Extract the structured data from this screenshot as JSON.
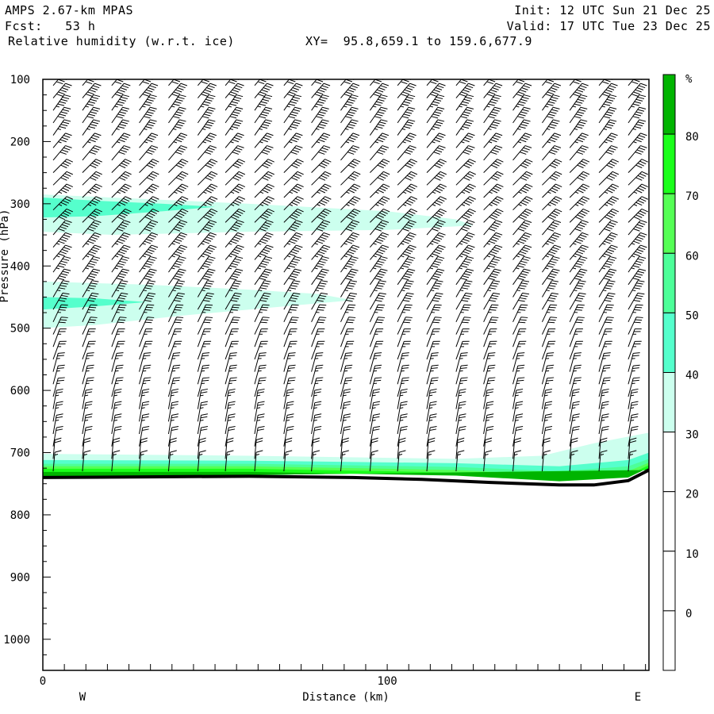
{
  "header": {
    "model": "AMPS 2.67-km MPAS",
    "forecast": "Fcst:   53 h",
    "field": "Relative humidity (w.r.t. ice)",
    "xy": "XY=  95.8,659.1 to 159.6,677.9",
    "init": "Init: 12 UTC Sun 21 Dec 25",
    "valid": "Valid: 17 UTC Tue 23 Dec 25"
  },
  "chart_data": {
    "type": "heatmap",
    "title": "Relative humidity (w.r.t. ice)",
    "xlabel": "Distance (km)",
    "ylabel": "Pressure (hPa)",
    "xlim": [
      0,
      176
    ],
    "ylim": [
      1050,
      100
    ],
    "xticks": [
      "0",
      "100"
    ],
    "xtick_values": [
      0,
      100
    ],
    "yticks": [
      "100",
      "200",
      "300",
      "400",
      "500",
      "600",
      "700",
      "800",
      "900",
      "1000"
    ],
    "ytick_values": [
      100,
      200,
      300,
      400,
      500,
      600,
      700,
      800,
      900,
      1000
    ],
    "left_label": "W",
    "right_label": "E",
    "colorbar": {
      "unit": "%",
      "labels": [
        "80",
        "70",
        "60",
        "50",
        "40",
        "30",
        "20",
        "10",
        "0"
      ],
      "levels": [
        90,
        80,
        70,
        60,
        50,
        40,
        30,
        20,
        10,
        0,
        -10
      ],
      "colors": [
        "#00b400",
        "#1aff1a",
        "#55ff55",
        "#4dff99",
        "#55ffcc",
        "#ccffee",
        "#ffffff",
        "#ffffff",
        "#ffffff",
        "#ffffff"
      ]
    },
    "terrain_hpa": [
      [
        0,
        740
      ],
      [
        30,
        739
      ],
      [
        60,
        738
      ],
      [
        90,
        740
      ],
      [
        110,
        743
      ],
      [
        130,
        748
      ],
      [
        150,
        752
      ],
      [
        160,
        752
      ],
      [
        170,
        745
      ],
      [
        176,
        728
      ]
    ],
    "rh_regions": [
      {
        "rh": 35,
        "poly": [
          [
            0,
            285
          ],
          [
            20,
            290
          ],
          [
            60,
            300
          ],
          [
            100,
            312
          ],
          [
            120,
            325
          ],
          [
            125,
            335
          ],
          [
            100,
            342
          ],
          [
            60,
            345
          ],
          [
            20,
            350
          ],
          [
            0,
            345
          ]
        ]
      },
      {
        "rh": 45,
        "poly": [
          [
            0,
            290
          ],
          [
            15,
            295
          ],
          [
            35,
            300
          ],
          [
            50,
            305
          ],
          [
            35,
            312
          ],
          [
            15,
            320
          ],
          [
            0,
            322
          ]
        ]
      },
      {
        "rh": 35,
        "poly": [
          [
            0,
            425
          ],
          [
            30,
            430
          ],
          [
            60,
            438
          ],
          [
            80,
            445
          ],
          [
            90,
            455
          ],
          [
            70,
            465
          ],
          [
            40,
            480
          ],
          [
            15,
            495
          ],
          [
            0,
            500
          ]
        ]
      },
      {
        "rh": 45,
        "poly": [
          [
            0,
            450
          ],
          [
            15,
            452
          ],
          [
            30,
            458
          ],
          [
            15,
            465
          ],
          [
            0,
            470
          ]
        ]
      },
      {
        "rh": 35,
        "poly": [
          [
            0,
            702
          ],
          [
            60,
            705
          ],
          [
            120,
            710
          ],
          [
            145,
            705
          ],
          [
            160,
            685
          ],
          [
            176,
            668
          ],
          [
            176,
            728
          ],
          [
            0,
            740
          ]
        ]
      },
      {
        "rh": 45,
        "poly": [
          [
            0,
            712
          ],
          [
            60,
            713
          ],
          [
            120,
            717
          ],
          [
            150,
            722
          ],
          [
            170,
            712
          ],
          [
            176,
            700
          ],
          [
            176,
            728
          ],
          [
            0,
            740
          ]
        ]
      },
      {
        "rh": 55,
        "poly": [
          [
            0,
            718
          ],
          [
            60,
            718
          ],
          [
            120,
            723
          ],
          [
            150,
            730
          ],
          [
            170,
            722
          ],
          [
            176,
            710
          ],
          [
            176,
            728
          ],
          [
            0,
            740
          ]
        ]
      },
      {
        "rh": 65,
        "poly": [
          [
            0,
            722
          ],
          [
            60,
            722
          ],
          [
            120,
            728
          ],
          [
            150,
            736
          ],
          [
            170,
            730
          ],
          [
            176,
            716
          ],
          [
            176,
            728
          ],
          [
            0,
            740
          ]
        ]
      },
      {
        "rh": 75,
        "poly": [
          [
            0,
            726
          ],
          [
            60,
            726
          ],
          [
            120,
            732
          ],
          [
            150,
            741
          ],
          [
            170,
            736
          ],
          [
            176,
            720
          ],
          [
            176,
            728
          ],
          [
            0,
            740
          ]
        ]
      },
      {
        "rh": 85,
        "poly": [
          [
            0,
            731
          ],
          [
            60,
            731
          ],
          [
            120,
            737
          ],
          [
            150,
            746
          ],
          [
            170,
            740
          ],
          [
            176,
            724
          ],
          [
            176,
            728
          ],
          [
            0,
            740
          ]
        ]
      }
    ],
    "wind_columns_km": [
      3,
      11.5,
      20,
      28,
      36.5,
      45,
      53,
      61.5,
      70,
      78,
      86.5,
      95,
      103,
      111.5,
      120,
      128,
      136.5,
      145,
      153,
      161.5,
      170
    ],
    "wind_profile": [
      [
        110,
        60,
        40
      ],
      [
        130,
        60,
        40
      ],
      [
        150,
        55,
        35
      ],
      [
        170,
        50,
        35
      ],
      [
        190,
        45,
        35
      ],
      [
        210,
        45,
        40
      ],
      [
        230,
        40,
        40
      ],
      [
        250,
        40,
        45
      ],
      [
        270,
        40,
        45
      ],
      [
        290,
        45,
        45
      ],
      [
        310,
        45,
        45
      ],
      [
        330,
        50,
        45
      ],
      [
        350,
        50,
        40
      ],
      [
        370,
        55,
        40
      ],
      [
        390,
        55,
        40
      ],
      [
        410,
        55,
        35
      ],
      [
        430,
        50,
        35
      ],
      [
        450,
        45,
        30
      ],
      [
        470,
        40,
        30
      ],
      [
        490,
        35,
        25
      ],
      [
        510,
        30,
        25
      ],
      [
        530,
        25,
        20
      ],
      [
        550,
        25,
        20
      ],
      [
        570,
        25,
        15
      ],
      [
        590,
        25,
        15
      ],
      [
        610,
        25,
        15
      ],
      [
        630,
        25,
        10
      ],
      [
        650,
        25,
        10
      ],
      [
        670,
        25,
        10
      ],
      [
        690,
        20,
        10
      ],
      [
        710,
        20,
        5
      ],
      [
        730,
        15,
        5
      ]
    ]
  }
}
